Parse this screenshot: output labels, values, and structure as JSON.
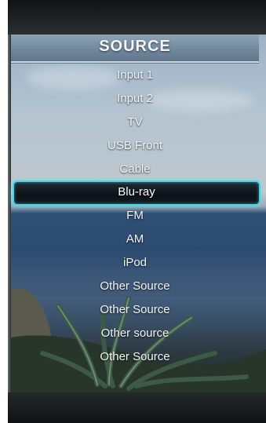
{
  "menu": {
    "title": "SOURCE",
    "selected_index": 5,
    "items": [
      {
        "label": "Input 1"
      },
      {
        "label": "Input 2"
      },
      {
        "label": "TV"
      },
      {
        "label": "USB Front"
      },
      {
        "label": "Cable"
      },
      {
        "label": "Blu-ray"
      },
      {
        "label": "FM"
      },
      {
        "label": "AM"
      },
      {
        "label": "iPod"
      },
      {
        "label": "Other Source"
      },
      {
        "label": "Other Source"
      },
      {
        "label": "Other source"
      },
      {
        "label": "Other Source"
      }
    ]
  },
  "colors": {
    "highlight_border": "#4fd2df",
    "text": "#f2f5f8"
  }
}
